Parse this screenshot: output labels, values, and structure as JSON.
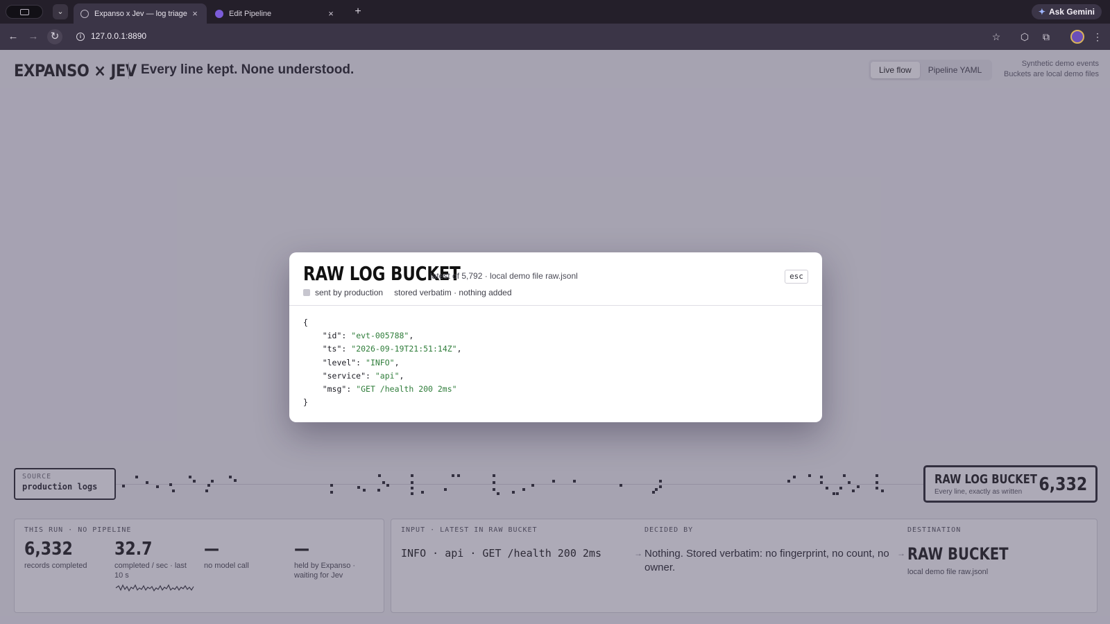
{
  "browser": {
    "tabs": [
      {
        "title": "Expanso x Jev — log triage",
        "active": true
      },
      {
        "title": "Edit Pipeline",
        "active": false
      }
    ],
    "new_tab": "+",
    "close": "×",
    "url": "127.0.0.1:8890",
    "ask_gemini": "Ask Gemini",
    "icons": {
      "back": "←",
      "forward": "→",
      "reload": "↻",
      "info": "i",
      "star": "☆",
      "extensions": "⬡",
      "puzzle": "⧉",
      "menu": "⋮",
      "tab_list": "⌄"
    }
  },
  "header": {
    "brand": "EXPANSO × JEV",
    "tagline": "Every line kept. None understood.",
    "views": [
      "Live flow",
      "Pipeline YAML"
    ],
    "notes": [
      "Synthetic demo events",
      "Buckets are local demo files"
    ]
  },
  "flow": {
    "source_label": "SOURCE",
    "source_value": "production logs",
    "destination_title": "RAW LOG BUCKET",
    "destination_subtitle": "Every line, exactly as written",
    "destination_count": "6,332"
  },
  "stats": {
    "caption": "THIS RUN · NO PIPELINE",
    "items": [
      {
        "value": "6,332",
        "label": "records completed"
      },
      {
        "value": "32.7",
        "label": "completed / sec · last 10 s"
      },
      {
        "value": "—",
        "label": "no model call"
      },
      {
        "value": "—",
        "label": "held by Expanso · waiting for Jev"
      }
    ]
  },
  "detail": {
    "input_caption": "INPUT · LATEST IN RAW BUCKET",
    "input_line": "INFO · api · GET /health 200 2ms",
    "decided_caption": "DECIDED BY",
    "decided_text": "Nothing. Stored verbatim: no fingerprint, no count, no owner.",
    "destination_caption": "DESTINATION",
    "destination_title": "RAW BUCKET",
    "destination_sub": "local demo file raw.jsonl",
    "arrow": "→"
  },
  "modal": {
    "title": "RAW LOG BUCKET",
    "meta": "latest of 5,792 · local demo file raw.jsonl",
    "esc": "esc",
    "tag1": "sent by production",
    "tag2": "stored verbatim · nothing added",
    "record": {
      "id": "evt-005788",
      "ts": "2026-09-19T21:51:14Z",
      "level": "INFO",
      "service": "api",
      "msg": "GET /health 200 2ms"
    },
    "code_open": "{",
    "code_close": "}",
    "keys": [
      "\"id\"",
      "\"ts\"",
      "\"level\"",
      "\"service\"",
      "\"msg\""
    ],
    "values": [
      "\"evt-005788\"",
      "\"2026-09-19T21:51:14Z\"",
      "\"INFO\"",
      "\"api\"",
      "\"GET /health 200 2ms\""
    ]
  }
}
